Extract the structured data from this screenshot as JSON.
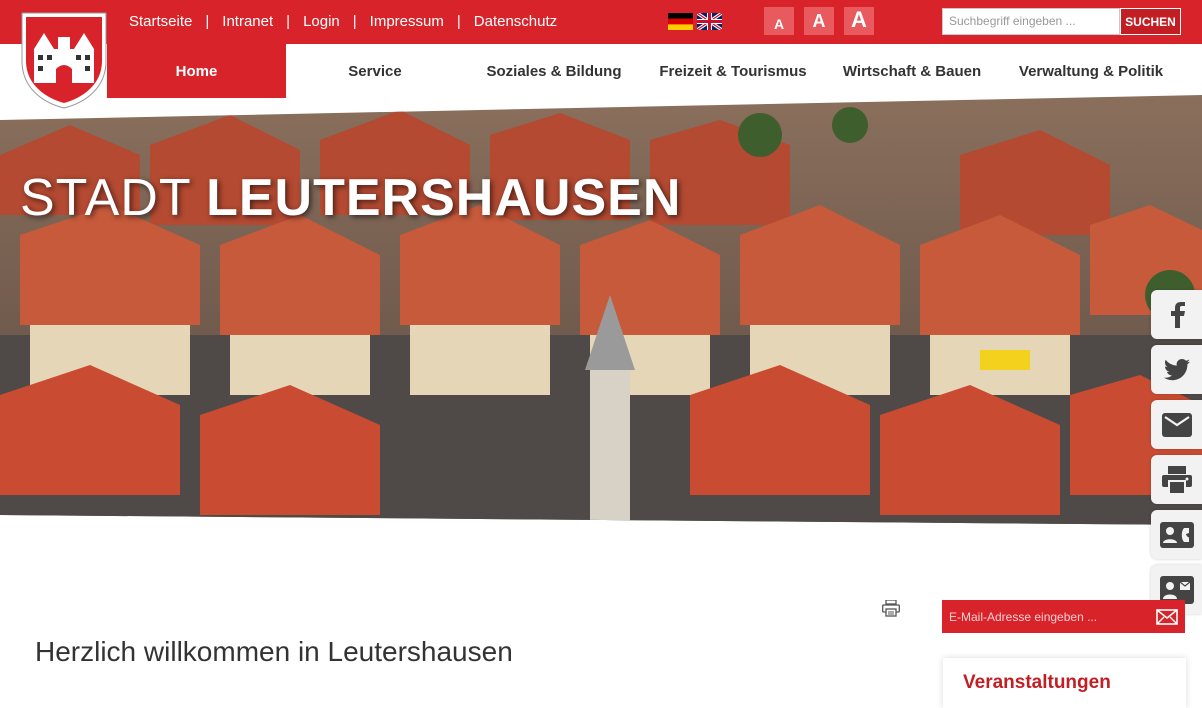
{
  "topnav": {
    "items": [
      "Startseite",
      "Intranet",
      "Login",
      "Impressum",
      "Datenschutz"
    ],
    "separator": "|"
  },
  "language": {
    "flags": [
      {
        "name": "german-flag-icon",
        "label": "Deutsch"
      },
      {
        "name": "uk-flag-icon",
        "label": "English"
      }
    ]
  },
  "fontsize": {
    "buttons": [
      "A",
      "A",
      "A"
    ]
  },
  "search": {
    "placeholder": "Suchbegriff eingeben ...",
    "button_label": "SUCHEN"
  },
  "mainnav": {
    "items": [
      "Home",
      "Service",
      "Soziales & Bildung",
      "Freizeit & Tourismus",
      "Wirtschaft & Bauen",
      "Verwaltung & Politik"
    ],
    "active": "Home"
  },
  "hero": {
    "title_light": "STADT",
    "title_bold": "LEUTERSHAUSEN"
  },
  "social": {
    "icons": [
      "facebook-icon",
      "twitter-icon",
      "email-icon",
      "print-icon",
      "contact-card-icon",
      "newsletter-card-icon"
    ]
  },
  "newsletter": {
    "placeholder": "E-Mail-Adresse eingeben ..."
  },
  "content": {
    "welcome_heading": "Herzlich willkommen in Leutershausen"
  },
  "sidebar": {
    "events_title": "Veranstaltungen"
  },
  "colors": {
    "brand_red": "#d8232a",
    "dark_red": "#c21f25",
    "light_red": "#e85a5e",
    "text": "#333333"
  }
}
